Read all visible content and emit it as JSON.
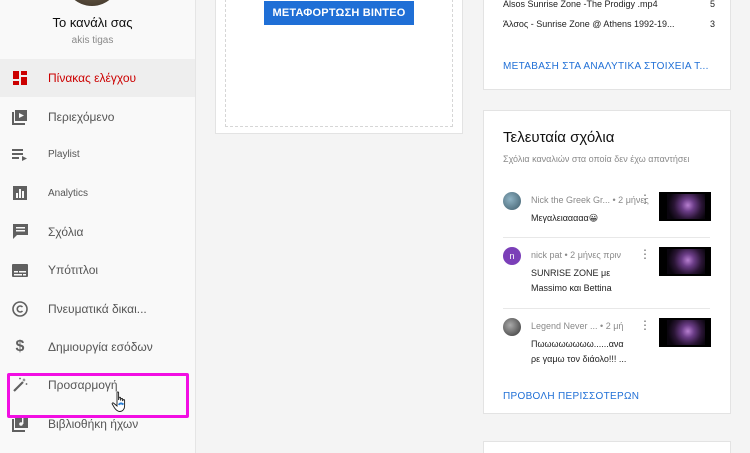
{
  "sidebar": {
    "channel_title": "Το κανάλι σας",
    "channel_user": "akis tigas",
    "items": [
      {
        "label": "Πίνακας ελέγχου",
        "icon": "dashboard-icon",
        "active": true
      },
      {
        "label": "Περιεχόμενο",
        "icon": "video-library-icon"
      },
      {
        "label": "Playlist",
        "icon": "playlist-icon"
      },
      {
        "label": "Analytics",
        "icon": "analytics-icon"
      },
      {
        "label": "Σχόλια",
        "icon": "comments-icon"
      },
      {
        "label": "Υπότιτλοι",
        "icon": "subtitles-icon"
      },
      {
        "label": "Πνευματικά δικαι...",
        "icon": "copyright-icon"
      },
      {
        "label": "Δημιουργία εσόδων",
        "icon": "dollar-icon"
      },
      {
        "label": "Προσαρμογή",
        "icon": "magic-wand-icon"
      },
      {
        "label": "Βιβλιοθήκη ήχων",
        "icon": "audio-library-icon"
      }
    ]
  },
  "upload": {
    "button_label": "ΜΕΤΑΦΟΡΤΩΣΗ ΒΙΝΤΕΟ"
  },
  "analytics": {
    "rows": [
      {
        "name": "Alsos Sunrise Zone -The Prodigy .mp4",
        "value": "5"
      },
      {
        "name": "Άλσος - Sunrise Zone @ Athens 1992-19...",
        "value": "3"
      }
    ],
    "link": "ΜΕΤΑΒΑΣΗ ΣΤΑ ΑΝΑΛΥΤΙΚΑ ΣΤΟΙΧΕΙΑ Τ..."
  },
  "comments": {
    "title": "Τελευταία σχόλια",
    "subtitle": "Σχόλια καναλιών στα οποία δεν έχω απαντήσει",
    "items": [
      {
        "author": "Nick the Greek Gr...",
        "time": " • 2 μήνες",
        "text": "Μεγαλειααααα😀",
        "avatar_color": "#4a6b7a",
        "avatar_letter": ""
      },
      {
        "author": "nick pat",
        "time": " • 2 μήνες πριν",
        "text": "SUNRISE ZONE με Massimo και Bettina",
        "avatar_color": "#7b3fb8",
        "avatar_letter": "n"
      },
      {
        "author": "Legend Never ...",
        "time": " • 2 μή",
        "text": "Πωωωωωωωω......ανα ρε γαμω τον διάολο!!! ...",
        "avatar_color": "#5a5a5a",
        "avatar_letter": ""
      }
    ],
    "more_link": "ΠΡΟΒΟΛΗ ΠΕΡΙΣΣΟΤΕΡΩΝ"
  },
  "colors": {
    "accent": "#1f6fd6",
    "active_nav": "#cc0000",
    "highlight": "#f20ee3"
  }
}
